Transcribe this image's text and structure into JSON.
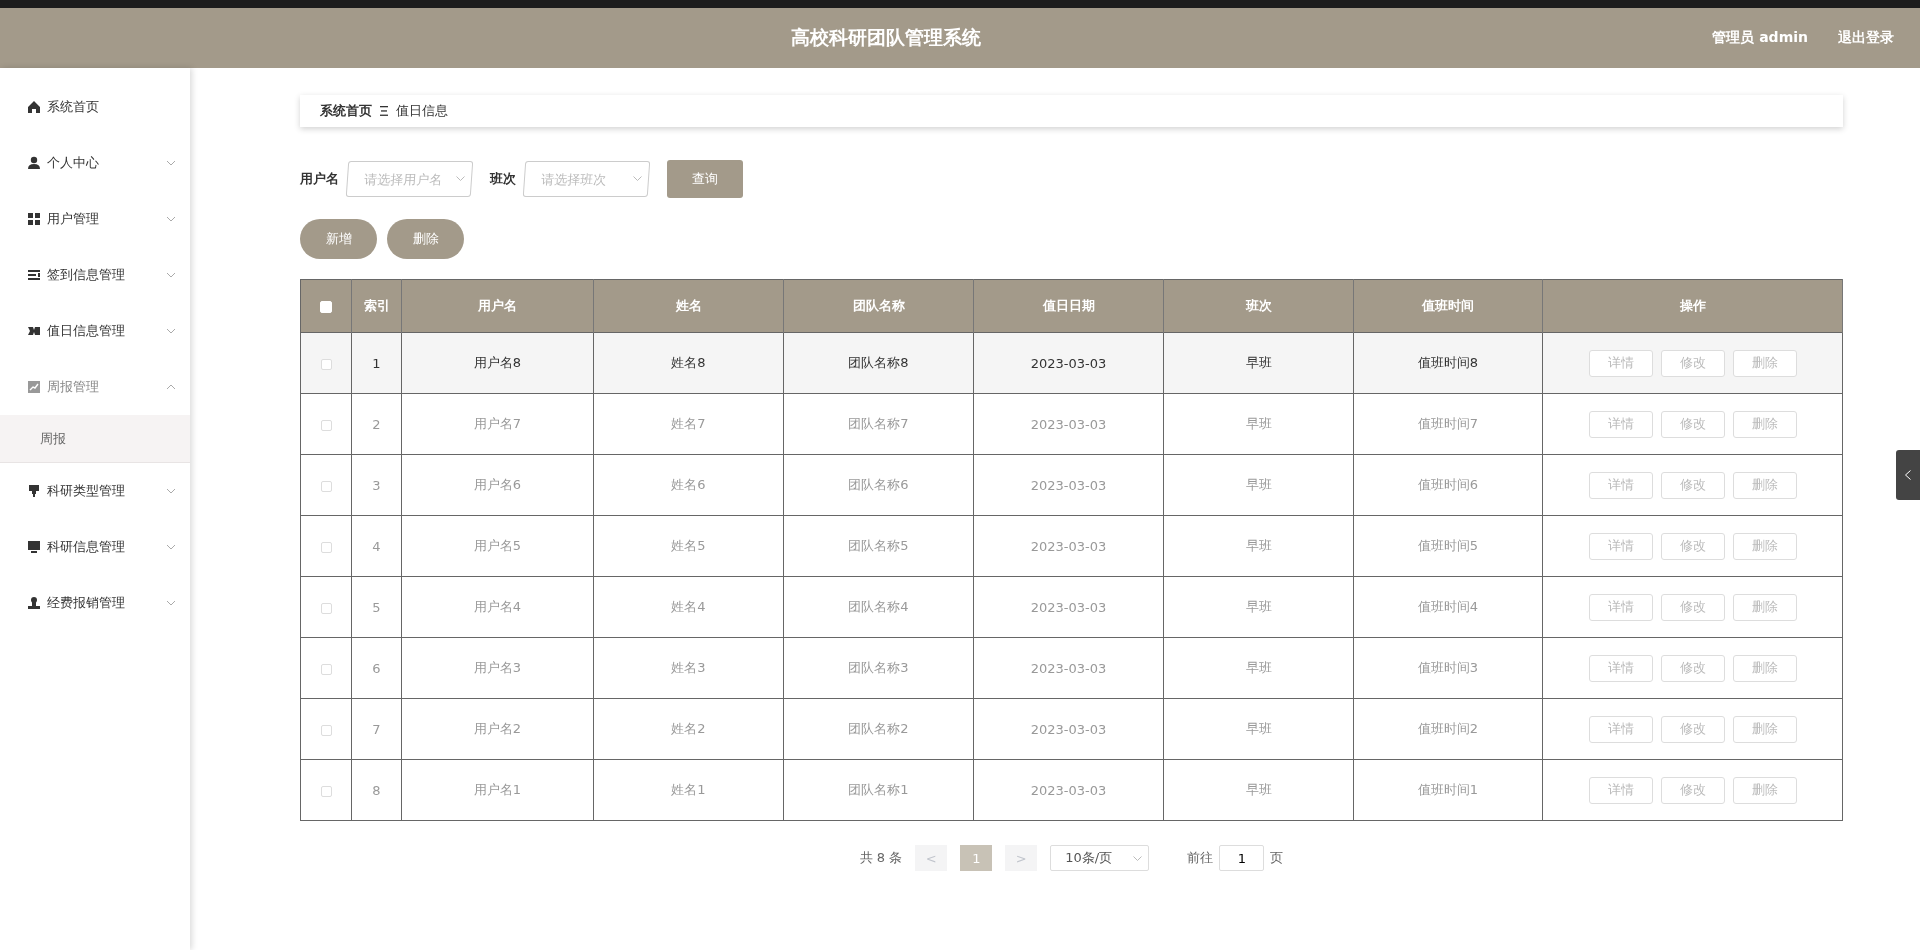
{
  "header": {
    "title": "高校科研团队管理系统",
    "user": "管理员 admin",
    "logout": "退出登录"
  },
  "sidebar": {
    "items": [
      {
        "label": "系统首页",
        "kind": "link"
      },
      {
        "label": "个人中心",
        "kind": "menu",
        "expanded": false
      },
      {
        "label": "用户管理",
        "kind": "menu",
        "expanded": false
      },
      {
        "label": "签到信息管理",
        "kind": "menu",
        "expanded": false
      },
      {
        "label": "值日信息管理",
        "kind": "menu",
        "expanded": false
      },
      {
        "label": "周报管理",
        "kind": "menu",
        "expanded": true,
        "children": [
          {
            "label": "周报",
            "selected": true
          }
        ]
      },
      {
        "label": "科研类型管理",
        "kind": "menu",
        "expanded": false
      },
      {
        "label": "科研信息管理",
        "kind": "menu",
        "expanded": false
      },
      {
        "label": "经费报销管理",
        "kind": "menu",
        "expanded": false
      }
    ]
  },
  "breadcrumb": [
    "系统首页",
    "值日信息"
  ],
  "search": {
    "fields": [
      {
        "label": "用户名",
        "placeholder": "请选择用户名"
      },
      {
        "label": "班次",
        "placeholder": "请选择班次"
      }
    ],
    "button": "查询"
  },
  "actions": [
    "新增",
    "删除"
  ],
  "table": {
    "select_all": {
      "checked": false
    },
    "columns": [
      "索引",
      "用户名",
      "姓名",
      "团队名称",
      "值日日期",
      "班次",
      "值班时间",
      "操作"
    ],
    "rows": [
      {
        "checked": false,
        "highlighted": true,
        "cells": [
          "1",
          "用户名8",
          "姓名8",
          "团队名称8",
          "2023-03-03",
          "早班",
          "值班时间8"
        ],
        "buttons": [
          "详情",
          "修改",
          "删除"
        ]
      },
      {
        "checked": false,
        "highlighted": false,
        "cells": [
          "2",
          "用户名7",
          "姓名7",
          "团队名称7",
          "2023-03-03",
          "早班",
          "值班时间7"
        ],
        "buttons": [
          "详情",
          "修改",
          "删除"
        ]
      },
      {
        "checked": false,
        "highlighted": false,
        "cells": [
          "3",
          "用户名6",
          "姓名6",
          "团队名称6",
          "2023-03-03",
          "早班",
          "值班时间6"
        ],
        "buttons": [
          "详情",
          "修改",
          "删除"
        ]
      },
      {
        "checked": false,
        "highlighted": false,
        "cells": [
          "4",
          "用户名5",
          "姓名5",
          "团队名称5",
          "2023-03-03",
          "早班",
          "值班时间5"
        ],
        "buttons": [
          "详情",
          "修改",
          "删除"
        ]
      },
      {
        "checked": false,
        "highlighted": false,
        "cells": [
          "5",
          "用户名4",
          "姓名4",
          "团队名称4",
          "2023-03-03",
          "早班",
          "值班时间4"
        ],
        "buttons": [
          "详情",
          "修改",
          "删除"
        ]
      },
      {
        "checked": false,
        "highlighted": false,
        "cells": [
          "6",
          "用户名3",
          "姓名3",
          "团队名称3",
          "2023-03-03",
          "早班",
          "值班时间3"
        ],
        "buttons": [
          "详情",
          "修改",
          "删除"
        ]
      },
      {
        "checked": false,
        "highlighted": false,
        "cells": [
          "7",
          "用户名2",
          "姓名2",
          "团队名称2",
          "2023-03-03",
          "早班",
          "值班时间2"
        ],
        "buttons": [
          "详情",
          "修改",
          "删除"
        ]
      },
      {
        "checked": false,
        "highlighted": false,
        "cells": [
          "8",
          "用户名1",
          "姓名1",
          "团队名称1",
          "2023-03-03",
          "早班",
          "值班时间1"
        ],
        "buttons": [
          "详情",
          "修改",
          "删除"
        ]
      }
    ]
  },
  "pagination": {
    "total": "共 8 条",
    "prev": "<",
    "pages": [
      {
        "label": "1",
        "selected": true
      }
    ],
    "next": ">",
    "page_size": "10条/页",
    "goto": "前往",
    "goto_value": "1",
    "goto_suffix": "页"
  }
}
